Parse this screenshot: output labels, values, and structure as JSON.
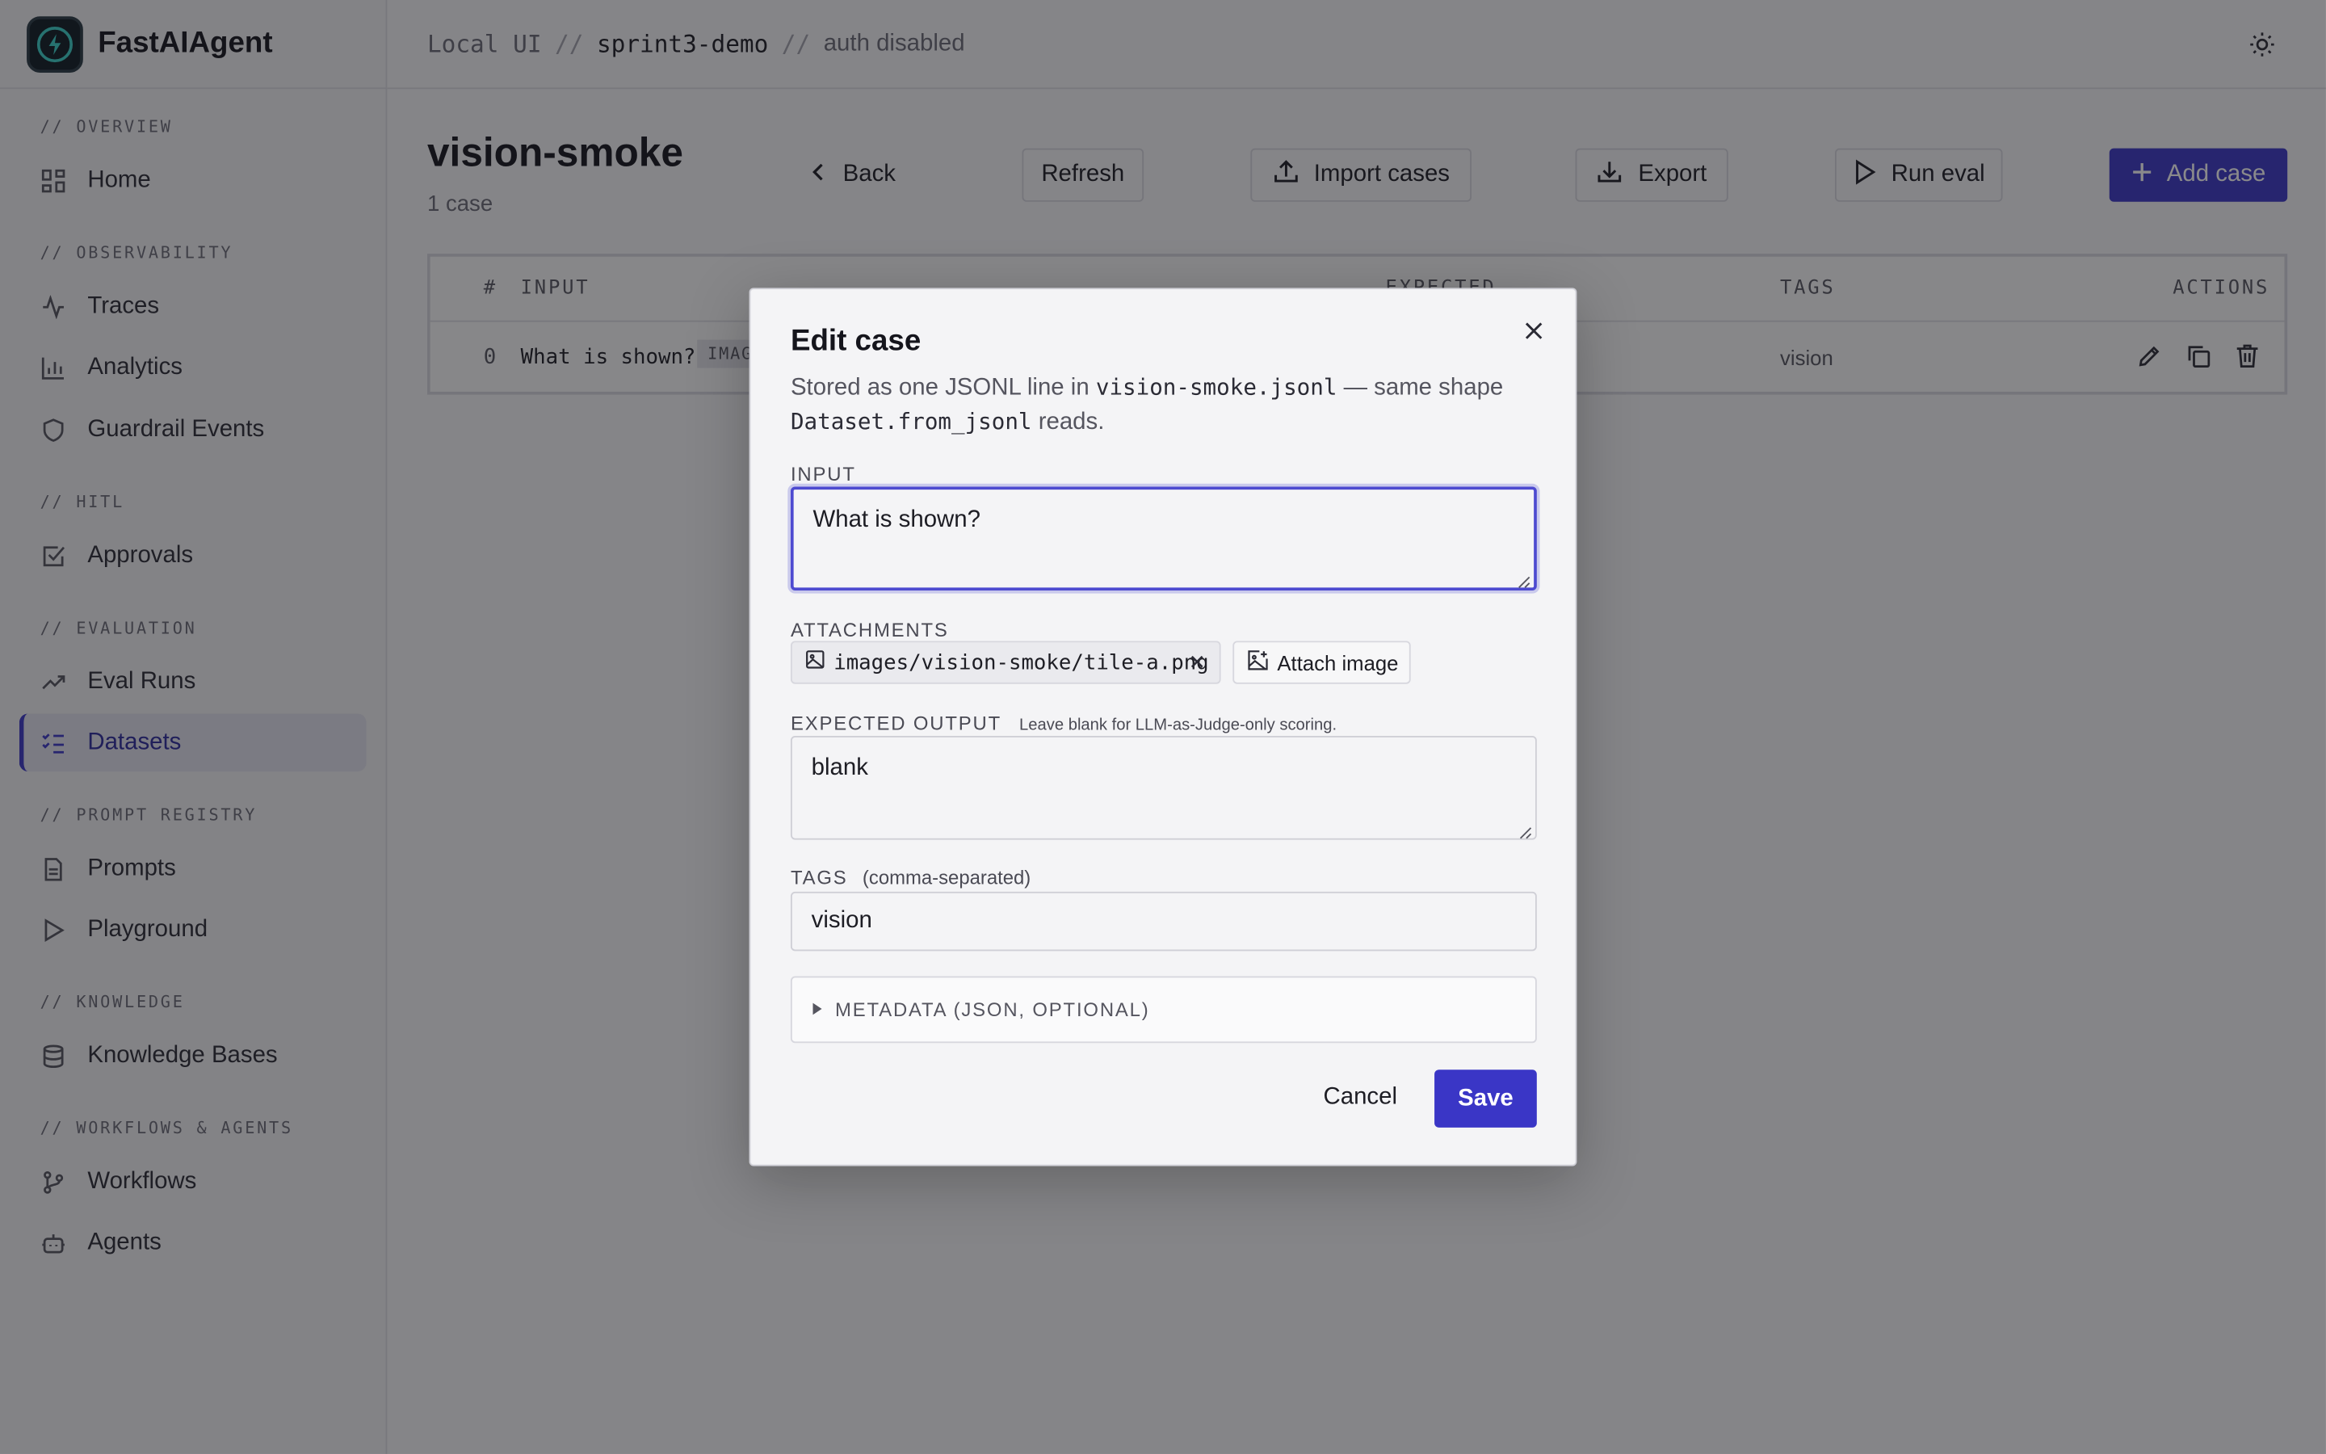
{
  "app": {
    "name": "FastAIAgent"
  },
  "breadcrumb": {
    "part1": "Local UI",
    "sep": "//",
    "part2": "sprint3-demo",
    "part3": "auth disabled"
  },
  "sidebar": {
    "sections": [
      {
        "label": "// OVERVIEW"
      },
      {
        "label": "// OBSERVABILITY"
      },
      {
        "label": "// HITL"
      },
      {
        "label": "// EVALUATION"
      },
      {
        "label": "// PROMPT REGISTRY"
      },
      {
        "label": "// KNOWLEDGE"
      },
      {
        "label": "// WORKFLOWS & AGENTS"
      }
    ],
    "items": [
      {
        "label": "Home",
        "icon": "grid-icon"
      },
      {
        "label": "Traces",
        "icon": "activity-icon"
      },
      {
        "label": "Analytics",
        "icon": "bar-chart-icon"
      },
      {
        "label": "Guardrail Events",
        "icon": "shield-icon"
      },
      {
        "label": "Approvals",
        "icon": "check-square-icon"
      },
      {
        "label": "Eval Runs",
        "icon": "trending-up-icon"
      },
      {
        "label": "Datasets",
        "icon": "list-checks-icon",
        "active": true
      },
      {
        "label": "Prompts",
        "icon": "file-text-icon"
      },
      {
        "label": "Playground",
        "icon": "play-icon"
      },
      {
        "label": "Knowledge Bases",
        "icon": "database-icon"
      },
      {
        "label": "Workflows",
        "icon": "git-branch-icon"
      },
      {
        "label": "Agents",
        "icon": "bot-icon"
      }
    ]
  },
  "page": {
    "title": "vision-smoke",
    "subtitle": "1 case",
    "toolbar": {
      "back": "Back",
      "refresh": "Refresh",
      "import": "Import cases",
      "export": "Export",
      "run_eval": "Run eval",
      "add_case": "Add case"
    }
  },
  "table": {
    "columns": [
      "#",
      "INPUT",
      "EXPECTED",
      "TAGS",
      "ACTIONS"
    ],
    "rows": [
      {
        "index": "0",
        "input": "What is shown?",
        "badge": "IMAG",
        "tags": "vision"
      }
    ]
  },
  "modal": {
    "title": "Edit case",
    "desc_pre": "Stored as one JSONL line in ",
    "desc_file": "vision-smoke.jsonl",
    "desc_mid": " — same shape ",
    "desc_fn": "Dataset.from_jsonl",
    "desc_post": " reads.",
    "input_label": "INPUT",
    "input_value": "What is shown?",
    "attachments_label": "ATTACHMENTS",
    "attachment_path": "images/vision-smoke/tile-a.png",
    "attach_button": "Attach image",
    "expected_label": "EXPECTED OUTPUT",
    "expected_hint": "Leave blank for LLM-as-Judge-only scoring.",
    "expected_value": "blank",
    "tags_label": "TAGS",
    "tags_hint": "(comma-separated)",
    "tags_value": "vision",
    "metadata_label": "METADATA (JSON, OPTIONAL)",
    "cancel": "Cancel",
    "save": "Save"
  },
  "colors": {
    "accent": "#3a36c6",
    "overlay": "rgba(20,20,24,0.5)"
  }
}
